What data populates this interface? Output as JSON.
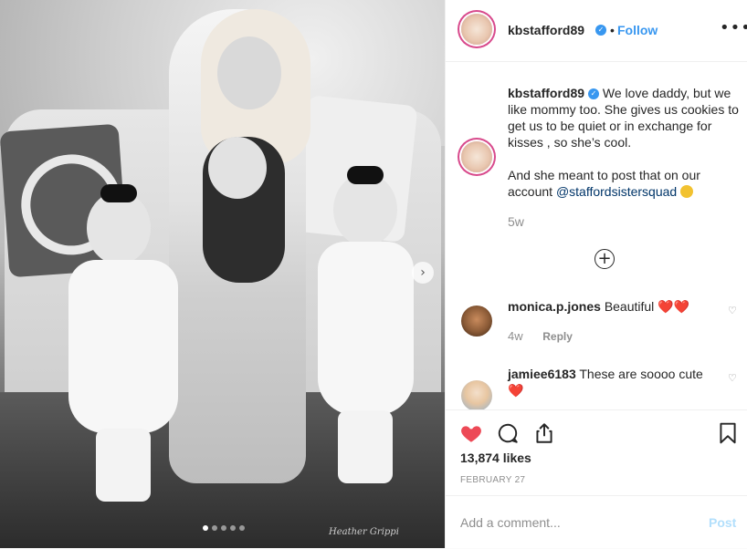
{
  "post": {
    "username": "kbstafford89",
    "follow_label": "Follow",
    "dot": "•",
    "more_label": "•••",
    "carousel_next": "›",
    "carousel_dots": 5,
    "carousel_active": 0,
    "watermark": "Heather Grippi"
  },
  "caption": {
    "username": "kbstafford89",
    "text_1": "We love daddy, but we like mommy too. She gives us cookies to get us to be quiet or in exchange for kisses , so she’s cool.",
    "text_2": "And she meant to post that on our account",
    "mention": "@staffordsistersquad",
    "age": "5w"
  },
  "load_more_label": "+",
  "comments": [
    {
      "username": "monica.p.jones",
      "text": "Beautiful",
      "emoji": "❤️❤️",
      "age": "4w",
      "reply_label": "Reply"
    },
    {
      "username": "jamiee6183",
      "text": "These are soooo cute",
      "emoji": "❤️"
    }
  ],
  "actions": {
    "likes": "13,874 likes",
    "date": "FEBRUARY 27",
    "liked": true,
    "like_color": "#ed4956"
  },
  "composer": {
    "placeholder": "Add a comment...",
    "post_label": "Post"
  },
  "colors": {
    "accent": "#3897f0",
    "text": "#262626",
    "muted": "#8e8e8e"
  }
}
